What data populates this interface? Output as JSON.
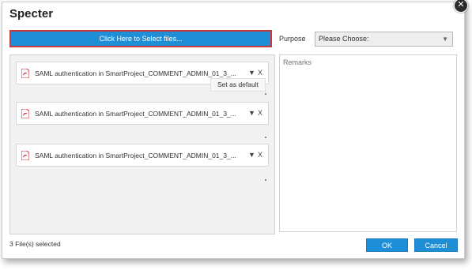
{
  "window": {
    "title": "Specter",
    "close_glyph": "✕"
  },
  "upload": {
    "select_files_label": "Click Here to Select files..."
  },
  "purpose": {
    "label": "Purpose",
    "selected": "Please Choose:"
  },
  "files": {
    "items": [
      {
        "name": "SAML authentication in SmartProject_COMMENT_ADMIN_01_3_...",
        "dropdown_glyph": "▼",
        "remove_glyph": "X",
        "icon": "pdf-icon"
      },
      {
        "name": "SAML authentication in SmartProject_COMMENT_ADMIN_01_3_...",
        "dropdown_glyph": "▼",
        "remove_glyph": "X",
        "icon": "pdf-icon"
      },
      {
        "name": "SAML authentication in SmartProject_COMMENT_ADMIN_01_3_...",
        "dropdown_glyph": "▼",
        "remove_glyph": "X",
        "icon": "pdf-icon"
      }
    ],
    "menu_item": "Set as default"
  },
  "remarks": {
    "placeholder": "Remarks"
  },
  "footer": {
    "status": "3 File(s) selected",
    "ok_label": "OK",
    "cancel_label": "Cancel"
  },
  "colors": {
    "accent": "#1e8fd6",
    "highlight_border": "#c93a3a",
    "pdf_red": "#d42b2b"
  }
}
